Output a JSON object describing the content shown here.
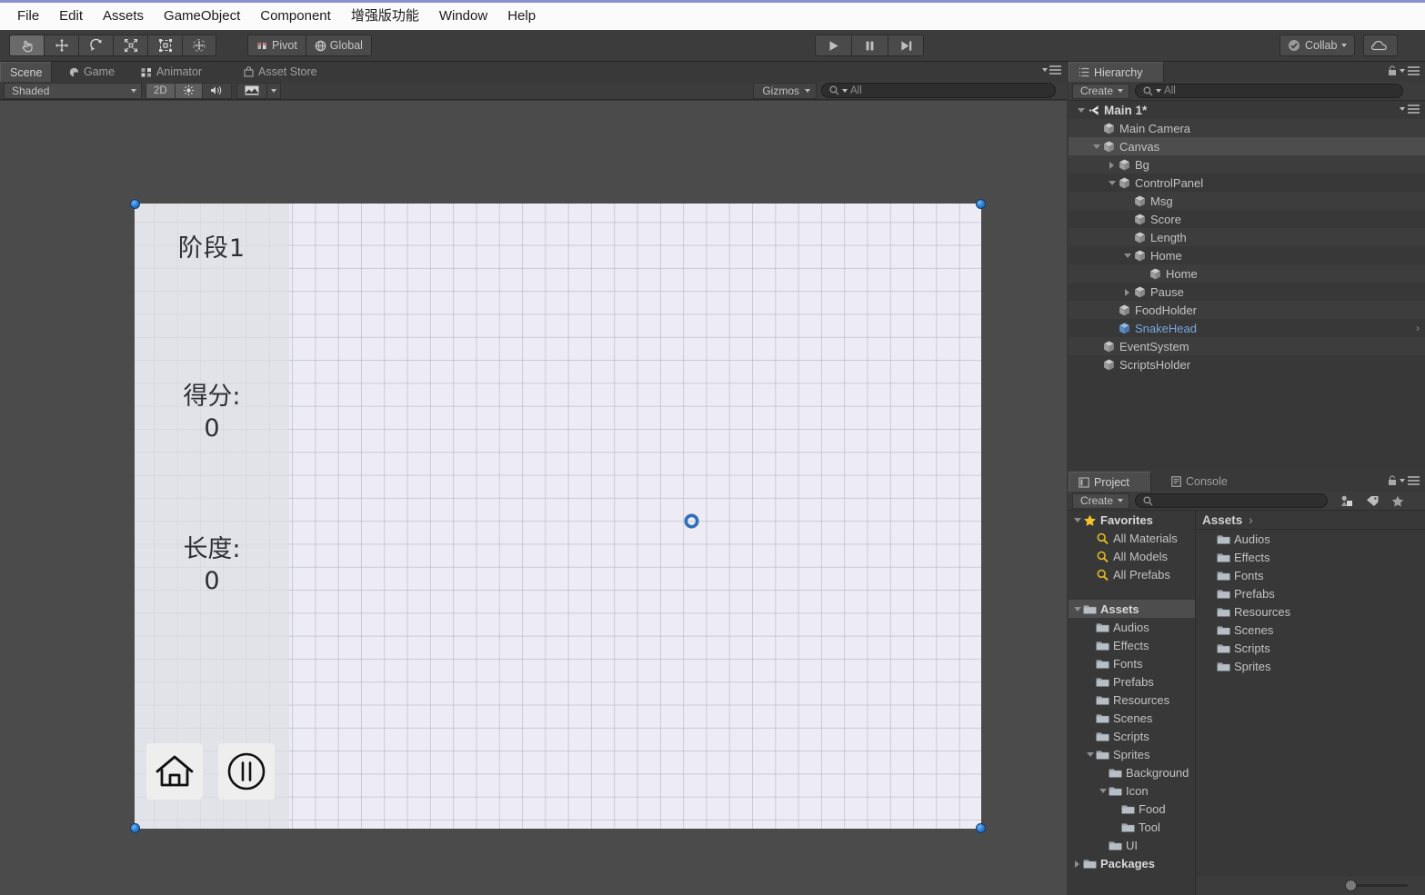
{
  "menubar": {
    "items": [
      {
        "label": "File"
      },
      {
        "label": "Edit"
      },
      {
        "label": "Assets"
      },
      {
        "label": "GameObject"
      },
      {
        "label": "Component"
      },
      {
        "label": "增强版功能"
      },
      {
        "label": "Window"
      },
      {
        "label": "Help"
      }
    ]
  },
  "toolbar": {
    "tools": [
      {
        "name": "hand-tool",
        "active": true
      },
      {
        "name": "move-tool",
        "active": false
      },
      {
        "name": "rotate-tool",
        "active": false
      },
      {
        "name": "scale-tool",
        "active": false
      },
      {
        "name": "rect-tool",
        "active": false
      },
      {
        "name": "transform-tool",
        "active": false
      }
    ],
    "pivot_label": "Pivot",
    "global_label": "Global",
    "play_label": "Play",
    "pause_label": "Pause",
    "step_label": "Step",
    "collab_label": "Collab",
    "cloud_label": "Cloud"
  },
  "scene_view": {
    "tabs": [
      {
        "label": "Scene",
        "icon": "",
        "active": true
      },
      {
        "label": "Game",
        "icon": "game-icon",
        "active": false
      },
      {
        "label": "Animator",
        "icon": "animator-icon",
        "active": false
      },
      {
        "label": "Asset Store",
        "icon": "asset-store-icon",
        "active": false
      }
    ],
    "shading_mode": "Shaded",
    "mode_2d": "2D",
    "lighting_icon": "sun-icon",
    "audio_icon": "speaker-icon",
    "fx_icon": "image-icon",
    "gizmos_label": "Gizmos",
    "search_value": "All",
    "search_placeholder": "All"
  },
  "game_canvas": {
    "msg": "阶段1",
    "score_label": "得分:",
    "score_value": "0",
    "length_label": "长度:",
    "length_value": "0",
    "home_button": "home-icon",
    "pause_button": "pause-icon",
    "snake_head": "snake-head-gizmo"
  },
  "hierarchy": {
    "tab_label": "Hierarchy",
    "create_label": "Create",
    "search_value": "All",
    "search_placeholder": "All",
    "items": [
      {
        "label": "Main 1*",
        "depth": 0,
        "arrow": "open",
        "icon": "unity-scene-icon",
        "selected": false,
        "alt": false,
        "root": true
      },
      {
        "label": "Main Camera",
        "depth": 1,
        "arrow": "none",
        "icon": "gameobject-icon",
        "selected": false,
        "alt": true
      },
      {
        "label": "Canvas",
        "depth": 1,
        "arrow": "open",
        "icon": "gameobject-icon",
        "selected": true,
        "alt": false
      },
      {
        "label": "Bg",
        "depth": 2,
        "arrow": "closed",
        "icon": "gameobject-icon",
        "selected": false,
        "alt": true
      },
      {
        "label": "ControlPanel",
        "depth": 2,
        "arrow": "open",
        "icon": "gameobject-icon",
        "selected": false,
        "alt": false
      },
      {
        "label": "Msg",
        "depth": 3,
        "arrow": "none",
        "icon": "gameobject-icon",
        "selected": false,
        "alt": true
      },
      {
        "label": "Score",
        "depth": 3,
        "arrow": "none",
        "icon": "gameobject-icon",
        "selected": false,
        "alt": false
      },
      {
        "label": "Length",
        "depth": 3,
        "arrow": "none",
        "icon": "gameobject-icon",
        "selected": false,
        "alt": true
      },
      {
        "label": "Home",
        "depth": 3,
        "arrow": "open",
        "icon": "gameobject-icon",
        "selected": false,
        "alt": false
      },
      {
        "label": "Home",
        "depth": 4,
        "arrow": "none",
        "icon": "gameobject-icon",
        "selected": false,
        "alt": true
      },
      {
        "label": "Pause",
        "depth": 3,
        "arrow": "closed",
        "icon": "gameobject-icon",
        "selected": false,
        "alt": false
      },
      {
        "label": "FoodHolder",
        "depth": 2,
        "arrow": "none",
        "icon": "gameobject-icon",
        "selected": false,
        "alt": true
      },
      {
        "label": "SnakeHead",
        "depth": 2,
        "arrow": "none",
        "icon": "prefab-icon",
        "selected": false,
        "alt": false,
        "blue": true,
        "extra": "›"
      },
      {
        "label": "EventSystem",
        "depth": 1,
        "arrow": "none",
        "icon": "gameobject-icon",
        "selected": false,
        "alt": true
      },
      {
        "label": "ScriptsHolder",
        "depth": 1,
        "arrow": "none",
        "icon": "gameobject-icon",
        "selected": false,
        "alt": false
      }
    ]
  },
  "project": {
    "tabs": [
      {
        "label": "Project",
        "icon": "project-icon",
        "active": true
      },
      {
        "label": "Console",
        "icon": "console-icon",
        "active": false
      }
    ],
    "create_label": "Create",
    "search_value": "",
    "search_placeholder": "",
    "toolbar_icons": [
      "scene-filter-icon",
      "label-filter-icon",
      "favorite-icon"
    ],
    "tree": [
      {
        "label": "Favorites",
        "depth": 0,
        "arrow": "open",
        "icon": "star-icon",
        "bold": true
      },
      {
        "label": "All Materials",
        "depth": 1,
        "arrow": "none",
        "icon": "search-icon"
      },
      {
        "label": "All Models",
        "depth": 1,
        "arrow": "none",
        "icon": "search-icon"
      },
      {
        "label": "All Prefabs",
        "depth": 1,
        "arrow": "none",
        "icon": "search-icon"
      },
      {
        "label": "",
        "depth": 0,
        "arrow": "none",
        "icon": "none",
        "spacer": true
      },
      {
        "label": "Assets",
        "depth": 0,
        "arrow": "open",
        "icon": "folder-icon",
        "bold": true,
        "selected": true
      },
      {
        "label": "Audios",
        "depth": 1,
        "arrow": "none",
        "icon": "folder-icon"
      },
      {
        "label": "Effects",
        "depth": 1,
        "arrow": "none",
        "icon": "folder-icon"
      },
      {
        "label": "Fonts",
        "depth": 1,
        "arrow": "none",
        "icon": "folder-icon"
      },
      {
        "label": "Prefabs",
        "depth": 1,
        "arrow": "none",
        "icon": "folder-icon"
      },
      {
        "label": "Resources",
        "depth": 1,
        "arrow": "none",
        "icon": "folder-icon"
      },
      {
        "label": "Scenes",
        "depth": 1,
        "arrow": "none",
        "icon": "folder-icon"
      },
      {
        "label": "Scripts",
        "depth": 1,
        "arrow": "none",
        "icon": "folder-icon"
      },
      {
        "label": "Sprites",
        "depth": 1,
        "arrow": "open",
        "icon": "folder-icon"
      },
      {
        "label": "Background",
        "depth": 2,
        "arrow": "none",
        "icon": "folder-icon"
      },
      {
        "label": "Icon",
        "depth": 2,
        "arrow": "open",
        "icon": "folder-icon"
      },
      {
        "label": "Food",
        "depth": 3,
        "arrow": "none",
        "icon": "folder-icon"
      },
      {
        "label": "Tool",
        "depth": 3,
        "arrow": "none",
        "icon": "folder-icon"
      },
      {
        "label": "UI",
        "depth": 2,
        "arrow": "none",
        "icon": "folder-icon"
      },
      {
        "label": "Packages",
        "depth": 0,
        "arrow": "closed",
        "icon": "folder-icon",
        "bold": true
      }
    ],
    "breadcrumb": "Assets",
    "contents": [
      {
        "label": "Audios",
        "icon": "folder-icon"
      },
      {
        "label": "Effects",
        "icon": "folder-icon"
      },
      {
        "label": "Fonts",
        "icon": "folder-icon"
      },
      {
        "label": "Prefabs",
        "icon": "folder-icon"
      },
      {
        "label": "Resources",
        "icon": "folder-icon"
      },
      {
        "label": "Scenes",
        "icon": "folder-icon"
      },
      {
        "label": "Scripts",
        "icon": "folder-icon"
      },
      {
        "label": "Sprites",
        "icon": "folder-icon"
      }
    ]
  },
  "colors": {
    "menubar_bg": "#fbfbfb",
    "accent_top": "#8b8fd0",
    "panel_bg": "#383838",
    "toolbar_bg": "#3c3c3c",
    "viewport_bg": "#4b4b4b",
    "canvas_bg": "#edecf5",
    "selection_blue": "#2a7fd4",
    "prefab_blue": "#7ba7dd"
  }
}
